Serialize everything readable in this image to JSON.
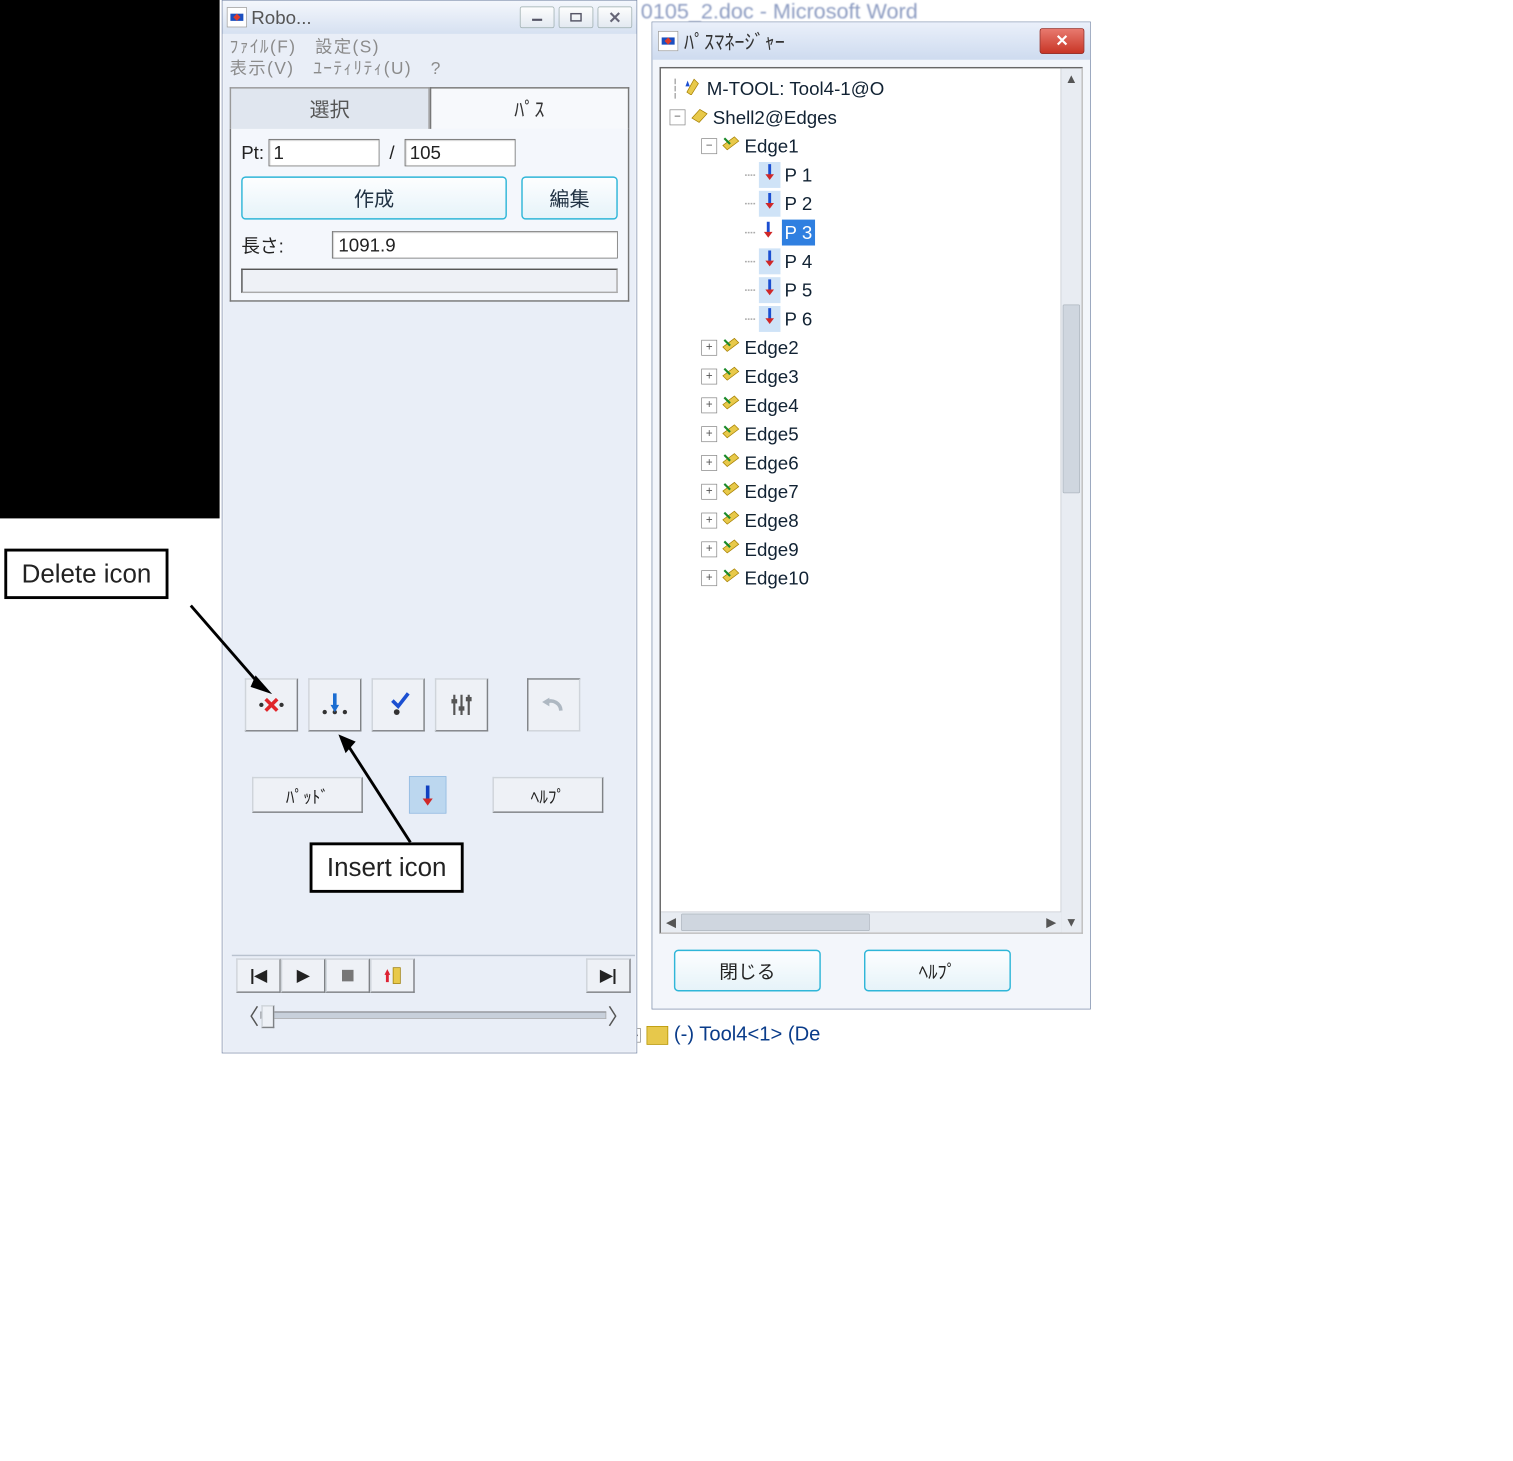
{
  "background": {
    "word_title": "0105_2.doc - Microsoft Word",
    "tool_item": "(-) Tool4<1> (De"
  },
  "callouts": {
    "delete": "Delete icon",
    "insert": "Insert icon"
  },
  "robo": {
    "title": "Robo...",
    "menu_line1": "ﾌｧｲﾙ(F)　設定(S)",
    "menu_line2": "表示(V)　ﾕｰﾃｨﾘﾃｨ(U)　?",
    "tabs": {
      "select": "選択",
      "path": "ﾊﾟｽ"
    },
    "pt_label": "Pt:",
    "pt_value": "1",
    "pt_sep": "/",
    "pt_total": "105",
    "btn_create": "作成",
    "btn_edit": "編集",
    "length_label": "長さ:",
    "length_value": "1091.9",
    "btn_pad": "ﾊﾟｯﾄﾞ",
    "btn_help": "ﾍﾙﾌﾟ"
  },
  "pm": {
    "title": "ﾊﾟｽﾏﾈｰｼﾞｬｰ",
    "btn_close": "閉じる",
    "btn_help": "ﾍﾙﾌﾟ",
    "tree": {
      "mtool": "M-TOOL: Tool4-1@O",
      "shell": "Shell2@Edges",
      "edge1": "Edge1",
      "points": [
        "P 1",
        "P 2",
        "P 3",
        "P 4",
        "P 5",
        "P 6"
      ],
      "selected_point_index": 2,
      "other_edges": [
        "Edge2",
        "Edge3",
        "Edge4",
        "Edge5",
        "Edge6",
        "Edge7",
        "Edge8",
        "Edge9",
        "Edge10"
      ]
    }
  }
}
